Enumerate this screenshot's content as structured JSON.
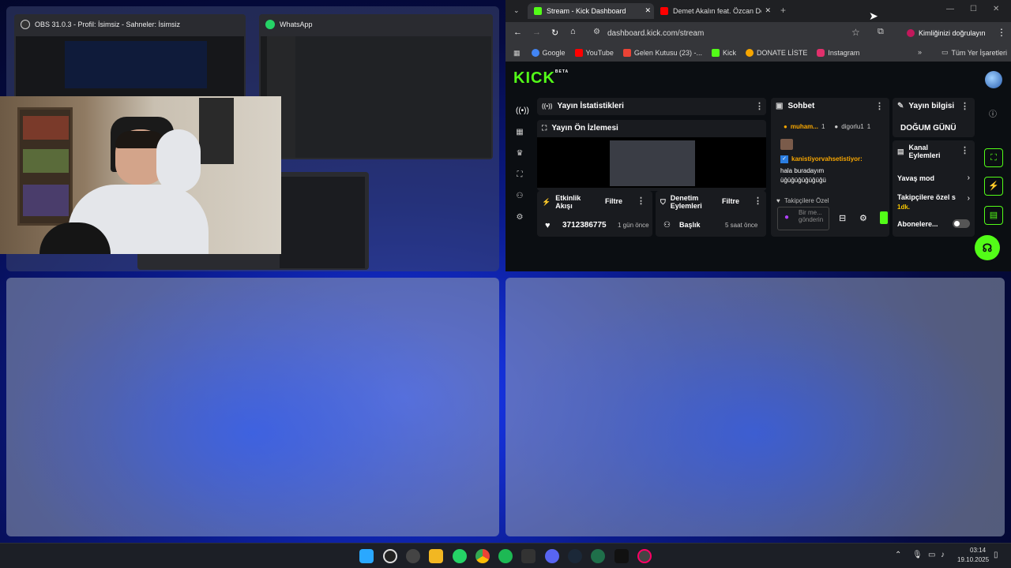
{
  "task_view": {
    "obs_window": {
      "title": "OBS 31.0.3 - Profil: İsimsiz - Sahneler: İsimsiz"
    },
    "whatsapp_window": {
      "title": "WhatsApp"
    }
  },
  "browser": {
    "tabs": [
      {
        "label": "Stream - Kick Dashboard",
        "active": true
      },
      {
        "label": "Demet Akalın feat. Özcan Deniz",
        "active": false
      }
    ],
    "url": "dashboard.kick.com/stream",
    "profile_label": "Kimliğinizi doğrulayın",
    "bookmarks": [
      {
        "label": "Google",
        "icon": "google-icon",
        "color": "#4285f4"
      },
      {
        "label": "YouTube",
        "icon": "youtube-icon",
        "color": "#ff0000"
      },
      {
        "label": "Gelen Kutusu (23) -...",
        "icon": "gmail-icon",
        "color": "#ea4335"
      },
      {
        "label": "Kick",
        "icon": "kick-icon",
        "color": "#53fc18"
      },
      {
        "label": "DONATE LİSTE",
        "icon": "donate-icon",
        "color": "#f7a600"
      },
      {
        "label": "Instagram",
        "icon": "instagram-icon",
        "color": "#e1306c"
      }
    ],
    "all_bookmarks": "Tüm Yer İşaretleri"
  },
  "kick": {
    "logo": "KICK",
    "logo_badge": "BETA",
    "brand_color": "#53fc18",
    "stats_panel": {
      "title": "Yayın İstatistikleri"
    },
    "preview_panel": {
      "title": "Yayın Ön İzlemesi"
    },
    "activity_panel": {
      "title": "Etkinlik Akışı",
      "filter": "Filtre",
      "item_name": "3712386775",
      "item_time": "1 gün önce"
    },
    "moderation_panel": {
      "title": "Denetim Eylemleri",
      "filter": "Filtre",
      "item_name": "Başlık",
      "item_time": "5 saat önce"
    },
    "chat_panel": {
      "title": "Sohbet",
      "pinned_user_1": "muham...",
      "pinned_count_1": "1",
      "pinned_user_2": "digorlu1",
      "pinned_count_2": "1",
      "message_user": "kanistiyorvahsetistiyor:",
      "message_text": "hala buradayım üğüğüğüğüğüğü",
      "followers_only": "Takipçilere Özel",
      "input_placeholder": "Bir me... gönderin"
    },
    "info_panel": {
      "title": "Yayın bilgisi",
      "stream_title": "DOĞUM GÜNÜ"
    },
    "actions_panel": {
      "title": "Kanal Eylemleri",
      "slow_mode": "Yavaş mod",
      "followers_only": "Takipçilere özel s",
      "followers_only_value": "1dk.",
      "subscribers": "Abonelere..."
    }
  },
  "taskbar": {
    "time": "03:14",
    "date": "19.10.2025"
  }
}
